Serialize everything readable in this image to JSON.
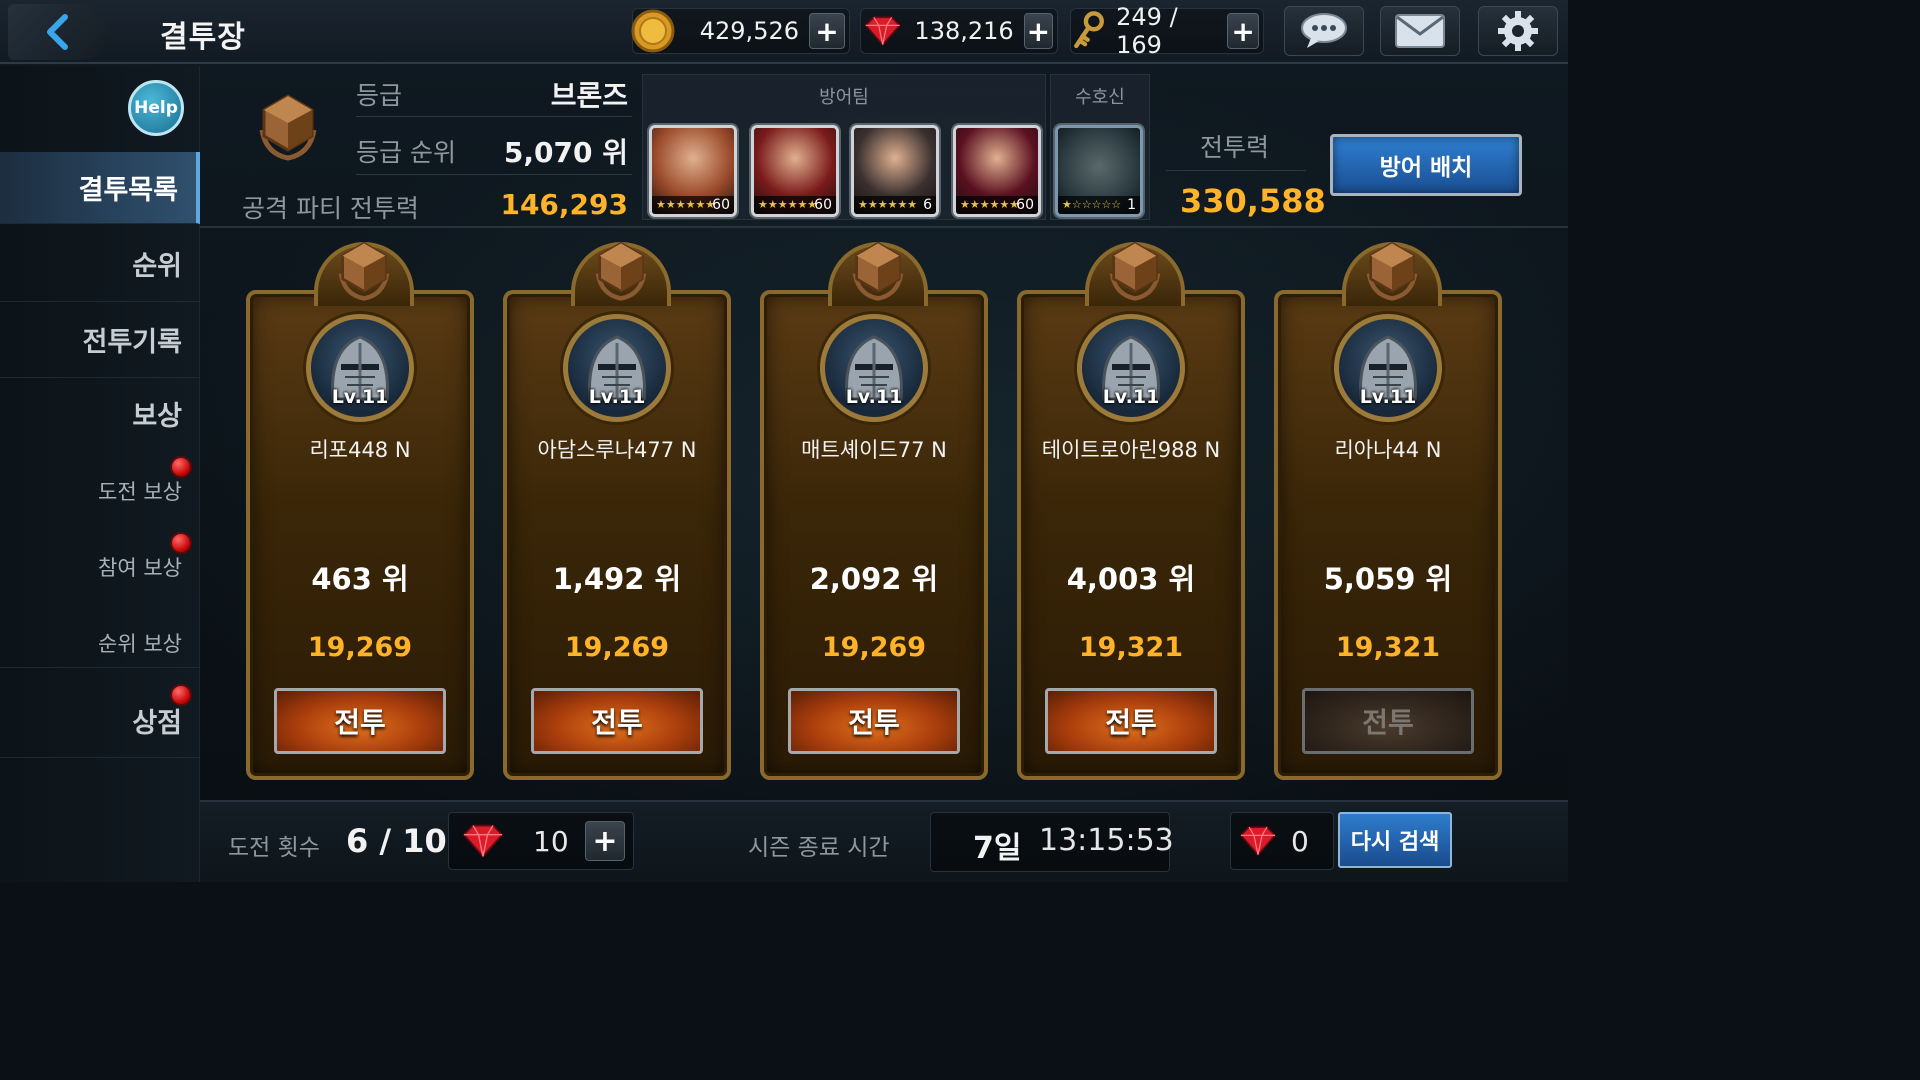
{
  "header": {
    "title": "결투장",
    "gold": "429,526",
    "gems": "138,216",
    "keys": "249 / 169"
  },
  "sidebar": {
    "help_label": "Help",
    "items": [
      {
        "label": "결투목록",
        "active": true
      },
      {
        "label": "순위"
      },
      {
        "label": "전투기록"
      },
      {
        "label": "보상"
      }
    ],
    "rewards": [
      {
        "label": "도전 보상",
        "notification": true
      },
      {
        "label": "참여 보상",
        "notification": true
      },
      {
        "label": "순위 보상",
        "notification": false
      }
    ],
    "shop": {
      "label": "상점",
      "notification": true
    }
  },
  "player": {
    "grade_label": "등급",
    "grade_value": "브론즈",
    "grade_rank_label": "등급 순위",
    "grade_rank_value": "5,070 위",
    "attack_power_label": "공격 파티 전투력",
    "attack_power_value": "146,293"
  },
  "defense": {
    "team_label": "방어팀",
    "guardian_label": "수호신",
    "heroes": [
      {
        "stars": "★★★★★★",
        "level": "60",
        "color": "#9a4a2a"
      },
      {
        "stars": "★★★★★★",
        "level": "60",
        "color": "#7a1a1a"
      },
      {
        "stars": "★★★★★★",
        "level": "6",
        "color": "#3a3030"
      },
      {
        "stars": "★★★★★★",
        "level": "60",
        "color": "#5a1020"
      }
    ],
    "guardian": {
      "stars": "★☆☆☆☆☆",
      "level": "1",
      "color": "#2a3a40"
    },
    "power_label": "전투력",
    "power_value": "330,588",
    "deploy_button": "방어 배치"
  },
  "opponents": [
    {
      "name": "리포448 N",
      "level": "Lv.11",
      "rank": "463 위",
      "power": "19,269",
      "button": "전투",
      "enabled": true
    },
    {
      "name": "아담스루나477 N",
      "level": "Lv.11",
      "rank": "1,492 위",
      "power": "19,269",
      "button": "전투",
      "enabled": true
    },
    {
      "name": "매트셰이드77 N",
      "level": "Lv.11",
      "rank": "2,092 위",
      "power": "19,269",
      "button": "전투",
      "enabled": true
    },
    {
      "name": "테이트로아린988 N",
      "level": "Lv.11",
      "rank": "4,003 위",
      "power": "19,321",
      "button": "전투",
      "enabled": true
    },
    {
      "name": "리아나44 N",
      "level": "Lv.11",
      "rank": "5,059 위",
      "power": "19,321",
      "button": "전투",
      "enabled": false
    }
  ],
  "footer": {
    "challenge_label": "도전 횟수",
    "challenge_value": "6 / 10",
    "refill_cost": "10",
    "season_label": "시즌 종료 시간",
    "season_days": "7일",
    "season_time": "13:15:53",
    "research_cost": "0",
    "research_button": "다시 검색"
  },
  "colors": {
    "gold_text": "#ffb328",
    "active_tab": "#30506e",
    "button_blue": "#2e7ccc",
    "battle_orange": "#e0701c",
    "card_border": "#8a6a2c"
  }
}
